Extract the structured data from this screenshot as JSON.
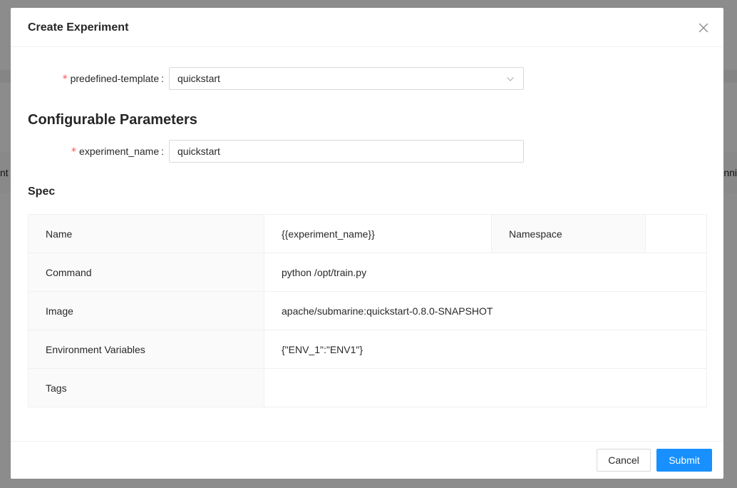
{
  "background": {
    "left_fragment": "nt",
    "right_fragment": "nni"
  },
  "modal": {
    "title": "Create Experiment",
    "close_icon": "close-icon"
  },
  "form": {
    "template": {
      "label": "predefined-template",
      "value": "quickstart",
      "required": true
    },
    "section_title": "Configurable Parameters",
    "experiment_name": {
      "label": "experiment_name",
      "value": "quickstart",
      "required": true
    }
  },
  "spec": {
    "title": "Spec",
    "rows": {
      "name": {
        "label": "Name",
        "value": "{{experiment_name}}",
        "namespace_label": "Namespace",
        "namespace_value": ""
      },
      "command": {
        "label": "Command",
        "value": "python /opt/train.py"
      },
      "image": {
        "label": "Image",
        "value": "apache/submarine:quickstart-0.8.0-SNAPSHOT"
      },
      "env": {
        "label": "Environment Variables",
        "value": "{\"ENV_1\":\"ENV1\"}"
      },
      "tags": {
        "label": "Tags",
        "value": ""
      }
    }
  },
  "footer": {
    "cancel_label": "Cancel",
    "submit_label": "Submit"
  },
  "colors": {
    "primary": "#1890ff",
    "required": "#ff4d4f"
  }
}
